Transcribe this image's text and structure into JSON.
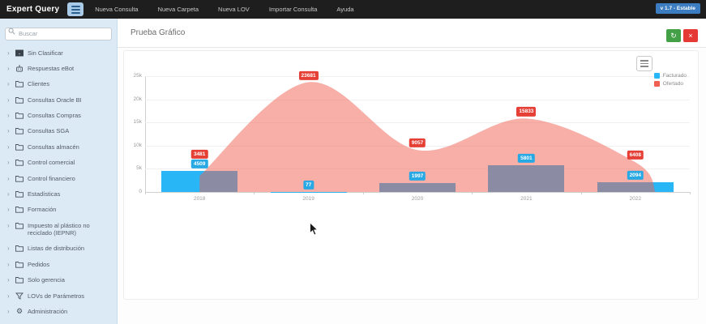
{
  "navbar": {
    "brand": "Expert Query",
    "items": [
      {
        "label": "Nueva Consulta"
      },
      {
        "label": "Nueva Carpeta"
      },
      {
        "label": "Nueva LOV"
      },
      {
        "label": "Importar Consulta"
      },
      {
        "label": "Ayuda"
      }
    ],
    "version_badge": "v 1.7 - Estable"
  },
  "sidebar": {
    "search_placeholder": "Buscar",
    "items": [
      {
        "label": "Sin Clasificar",
        "icon": "inbox-icon"
      },
      {
        "label": "Respuestas eBot",
        "icon": "robot-icon"
      },
      {
        "label": "Clientes",
        "icon": "folder-icon"
      },
      {
        "label": "Consultas Oracle BI",
        "icon": "folder-icon"
      },
      {
        "label": "Consultas Compras",
        "icon": "folder-icon"
      },
      {
        "label": "Consultas SGA",
        "icon": "folder-icon"
      },
      {
        "label": "Consultas almacén",
        "icon": "folder-icon"
      },
      {
        "label": "Control comercial",
        "icon": "folder-icon"
      },
      {
        "label": "Control financiero",
        "icon": "folder-icon"
      },
      {
        "label": "Estadísticas",
        "icon": "folder-icon"
      },
      {
        "label": "Formación",
        "icon": "folder-icon"
      },
      {
        "label": "Impuesto al plástico no reciclado (IEPNR)",
        "icon": "folder-icon"
      },
      {
        "label": "Listas de distribución",
        "icon": "folder-icon"
      },
      {
        "label": "Pedidos",
        "icon": "folder-icon"
      },
      {
        "label": "Solo gerencia",
        "icon": "folder-icon"
      },
      {
        "label": "LOVs de Parámetros",
        "icon": "filter-icon"
      },
      {
        "label": "Administración",
        "icon": "gear-icon"
      }
    ]
  },
  "main": {
    "title": "Prueba Gráfico",
    "refresh_icon": "↻",
    "close_icon": "×"
  },
  "chart_data": {
    "type": "combo",
    "categories": [
      "2018",
      "2019",
      "2020",
      "2021",
      "2022"
    ],
    "series": [
      {
        "name": "Facturado",
        "type": "bar",
        "color": "#29b6f6",
        "label_bg": "#29a9e4",
        "values": [
          4509,
          77,
          1997,
          5801,
          2094
        ]
      },
      {
        "name": "Ofertado",
        "type": "area",
        "color": "#ef5f52",
        "label_bg": "#e64036",
        "values": [
          3481,
          23681,
          9057,
          15833,
          6408
        ]
      }
    ],
    "yticks": [
      "0",
      "5k",
      "10k",
      "15k",
      "20k",
      "25k"
    ],
    "ylim": [
      0,
      25000
    ],
    "grid": true,
    "legend_position": "top-right",
    "area_opacity": 0.5
  }
}
